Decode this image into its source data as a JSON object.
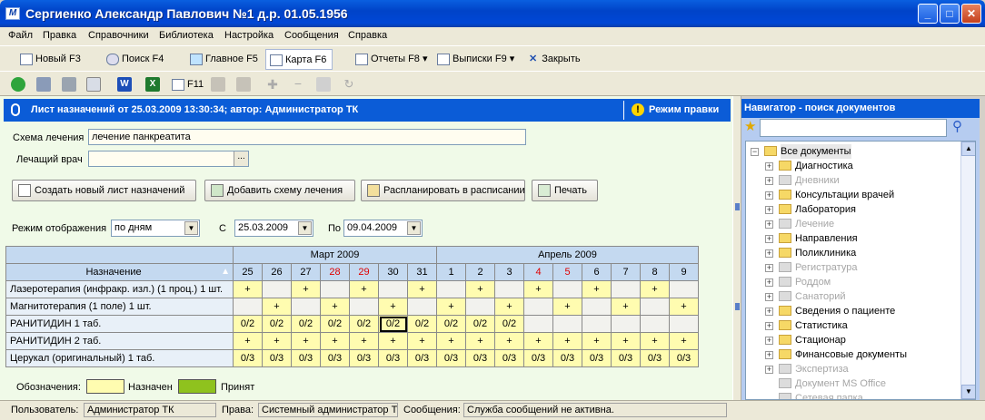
{
  "window": {
    "title": "Сергиенко Александр Павлович  №1  д.р. 01.05.1956",
    "app_icon": "app-logo-icon"
  },
  "menu": [
    "Файл",
    "Правка",
    "Справочники",
    "Библиотека",
    "Настройка",
    "Сообщения",
    "Справка"
  ],
  "toolbar": {
    "new": "Новый  F3",
    "search": "Поиск  F4",
    "home": "Главное F5",
    "card": "Карта F6",
    "reports": "Отчеты F8",
    "extracts": "Выписки F9",
    "close": "Закрыть",
    "f11": "F11"
  },
  "doc": {
    "title": "Лист назначений от 25.03.2009 13:30:34; автор: Администратор ТК",
    "edit_mode": "Режим правки"
  },
  "form": {
    "scheme_label": "Схема лечения",
    "scheme_value": "лечение панкреатита",
    "doctor_label": "Лечащий врач",
    "doctor_value": "",
    "btn_new_sheet": "Создать новый лист назначений",
    "btn_add_scheme": "Добавить схему лечения",
    "btn_schedule": "Распланировать в расписании",
    "btn_print": "Печать",
    "mode_label": "Режим отображения",
    "mode_value": "по дням",
    "from_label": "С",
    "from_value": "25.03.2009",
    "to_label": "По",
    "to_value": "09.04.2009"
  },
  "grid": {
    "month1": "Март 2009",
    "month2": "Апрель 2009",
    "name_header": "Назначение",
    "days": [
      "25",
      "26",
      "27",
      "28",
      "29",
      "30",
      "31",
      "1",
      "2",
      "3",
      "4",
      "5",
      "6",
      "7",
      "8",
      "9"
    ],
    "red_days": [
      3,
      4,
      10,
      11
    ],
    "rows": [
      {
        "name": "Лазеротерапия (инфракр. изл.) (1 проц.) 1 шт.",
        "cells": [
          "+",
          "",
          "+",
          "",
          "+",
          "",
          "+",
          "",
          "+",
          "",
          "+",
          "",
          "+",
          "",
          "+",
          ""
        ],
        "yellow": [
          0,
          2,
          4,
          6,
          8,
          10,
          12,
          14
        ]
      },
      {
        "name": "Магнитотерапия (1 поле) 1 шт.",
        "cells": [
          "",
          "+",
          "",
          "+",
          "",
          "+",
          "",
          "+",
          "",
          "+",
          "",
          "+",
          "",
          "+",
          "",
          "+"
        ],
        "yellow": [
          1,
          3,
          5,
          7,
          9,
          11,
          13,
          15
        ]
      },
      {
        "name": "РАНИТИДИН 1 таб.",
        "cells": [
          "0/2",
          "0/2",
          "0/2",
          "0/2",
          "0/2",
          "0/2",
          "0/2",
          "0/2",
          "0/2",
          "0/2",
          "",
          "",
          "",
          "",
          "",
          ""
        ],
        "yellow": [
          0,
          1,
          2,
          3,
          4,
          5,
          6,
          7,
          8,
          9
        ]
      },
      {
        "name": "РАНИТИДИН 2 таб.",
        "cells": [
          "+",
          "+",
          "+",
          "+",
          "+",
          "+",
          "+",
          "+",
          "+",
          "+",
          "+",
          "+",
          "+",
          "+",
          "+",
          "+"
        ],
        "yellow": [
          0,
          1,
          2,
          3,
          4,
          5,
          6,
          7,
          8,
          9,
          10,
          11,
          12,
          13,
          14,
          15
        ]
      },
      {
        "name": "Церукал (оригинальный)  1 таб.",
        "cells": [
          "0/3",
          "0/3",
          "0/3",
          "0/3",
          "0/3",
          "0/3",
          "0/3",
          "0/3",
          "0/3",
          "0/3",
          "0/3",
          "0/3",
          "0/3",
          "0/3",
          "0/3",
          "0/3"
        ],
        "yellow": [
          0,
          1,
          2,
          3,
          4,
          5,
          6,
          7,
          8,
          9,
          10,
          11,
          12,
          13,
          14,
          15
        ]
      }
    ]
  },
  "legend": {
    "label": "Обозначения:",
    "assigned": "Назначен",
    "accepted": "Принят",
    "assigned_color": "#fffcb0",
    "accepted_color": "#8fc21e"
  },
  "navigator": {
    "title": "Навигатор - поиск документов",
    "root": "Все документы",
    "items": [
      {
        "label": "Диагностика",
        "enabled": true
      },
      {
        "label": "Дневники",
        "enabled": false
      },
      {
        "label": "Консультации врачей",
        "enabled": true
      },
      {
        "label": "Лаборатория",
        "enabled": true
      },
      {
        "label": "Лечение",
        "enabled": false
      },
      {
        "label": "Направления",
        "enabled": true
      },
      {
        "label": "Поликлиника",
        "enabled": true
      },
      {
        "label": "Регистратура",
        "enabled": false
      },
      {
        "label": "Роддом",
        "enabled": false
      },
      {
        "label": "Санаторий",
        "enabled": false
      },
      {
        "label": "Сведения о пациенте",
        "enabled": true
      },
      {
        "label": "Статистика",
        "enabled": true
      },
      {
        "label": "Стационар",
        "enabled": true
      },
      {
        "label": "Финансовые документы",
        "enabled": true
      },
      {
        "label": "Экспертиза",
        "enabled": false
      },
      {
        "label": "Документ MS Office",
        "enabled": false
      },
      {
        "label": "Сетевая папка",
        "enabled": false
      }
    ]
  },
  "status": {
    "user_label": "Пользователь:",
    "user_value": "Администратор ТК",
    "rights_label": "Права:",
    "rights_value": "Системный администратор Т",
    "msg_label": "Сообщения:",
    "msg_value": "Служба сообщений не активна."
  }
}
